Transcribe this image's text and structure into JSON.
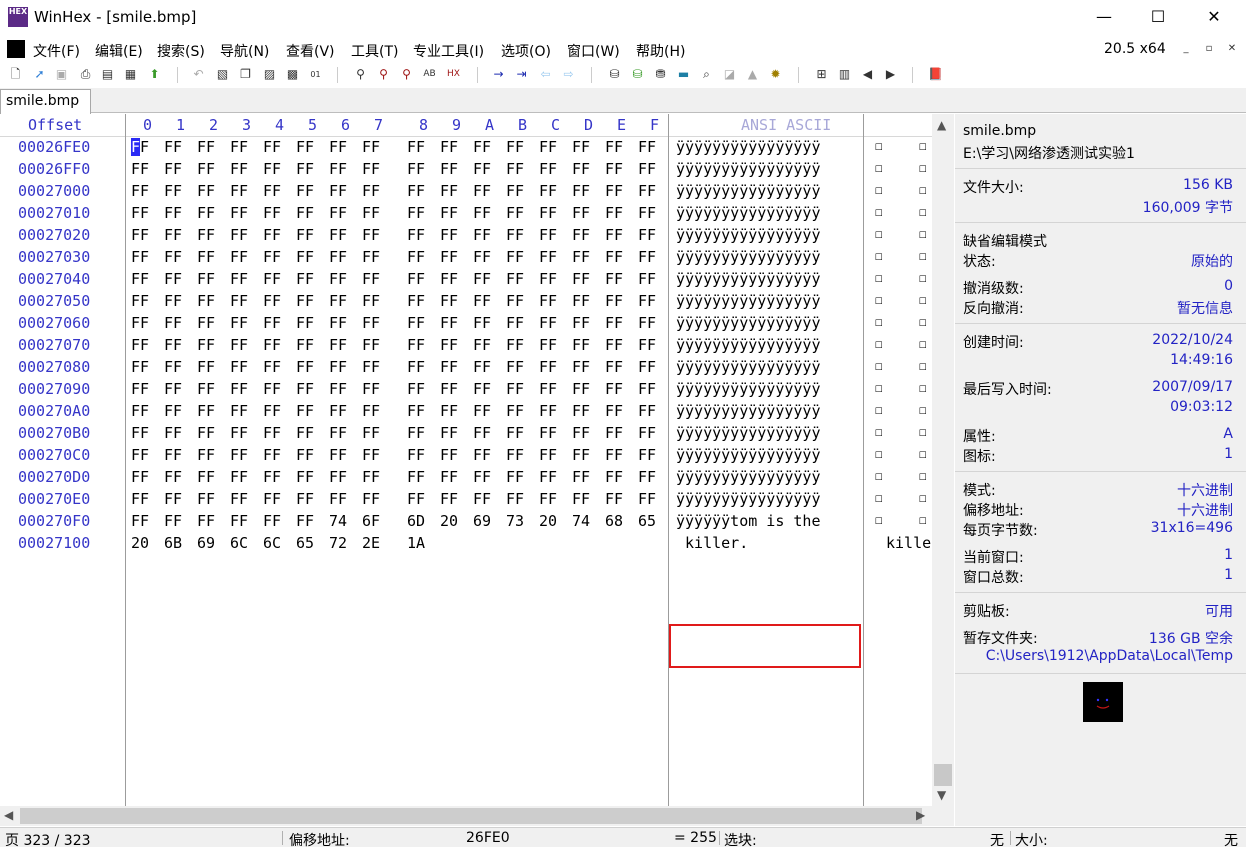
{
  "window": {
    "title": "WinHex - [smile.bmp]",
    "app_icon_text": "HEX"
  },
  "menu": {
    "items": [
      "文件(F)",
      "编辑(E)",
      "搜索(S)",
      "导航(N)",
      "查看(V)",
      "工具(T)",
      "专业工具(I)",
      "选项(O)",
      "窗口(W)",
      "帮助(H)"
    ],
    "version": "20.5 x64"
  },
  "tab": {
    "label": "smile.bmp"
  },
  "hex": {
    "offset_header": "Offset",
    "column_headers": [
      "0",
      "1",
      "2",
      "3",
      "4",
      "5",
      "6",
      "7",
      "8",
      "9",
      "A",
      "B",
      "C",
      "D",
      "E",
      "F"
    ],
    "ascii_header": "ANSI ASCII",
    "rows": [
      {
        "offset": "00026FE0",
        "bytes": [
          "FF",
          "FF",
          "FF",
          "FF",
          "FF",
          "FF",
          "FF",
          "FF",
          "FF",
          "FF",
          "FF",
          "FF",
          "FF",
          "FF",
          "FF",
          "FF"
        ],
        "ascii": "ÿÿÿÿÿÿÿÿÿÿÿÿÿÿÿÿ"
      },
      {
        "offset": "00026FF0",
        "bytes": [
          "FF",
          "FF",
          "FF",
          "FF",
          "FF",
          "FF",
          "FF",
          "FF",
          "FF",
          "FF",
          "FF",
          "FF",
          "FF",
          "FF",
          "FF",
          "FF"
        ],
        "ascii": "ÿÿÿÿÿÿÿÿÿÿÿÿÿÿÿÿ"
      },
      {
        "offset": "00027000",
        "bytes": [
          "FF",
          "FF",
          "FF",
          "FF",
          "FF",
          "FF",
          "FF",
          "FF",
          "FF",
          "FF",
          "FF",
          "FF",
          "FF",
          "FF",
          "FF",
          "FF"
        ],
        "ascii": "ÿÿÿÿÿÿÿÿÿÿÿÿÿÿÿÿ"
      },
      {
        "offset": "00027010",
        "bytes": [
          "FF",
          "FF",
          "FF",
          "FF",
          "FF",
          "FF",
          "FF",
          "FF",
          "FF",
          "FF",
          "FF",
          "FF",
          "FF",
          "FF",
          "FF",
          "FF"
        ],
        "ascii": "ÿÿÿÿÿÿÿÿÿÿÿÿÿÿÿÿ"
      },
      {
        "offset": "00027020",
        "bytes": [
          "FF",
          "FF",
          "FF",
          "FF",
          "FF",
          "FF",
          "FF",
          "FF",
          "FF",
          "FF",
          "FF",
          "FF",
          "FF",
          "FF",
          "FF",
          "FF"
        ],
        "ascii": "ÿÿÿÿÿÿÿÿÿÿÿÿÿÿÿÿ"
      },
      {
        "offset": "00027030",
        "bytes": [
          "FF",
          "FF",
          "FF",
          "FF",
          "FF",
          "FF",
          "FF",
          "FF",
          "FF",
          "FF",
          "FF",
          "FF",
          "FF",
          "FF",
          "FF",
          "FF"
        ],
        "ascii": "ÿÿÿÿÿÿÿÿÿÿÿÿÿÿÿÿ"
      },
      {
        "offset": "00027040",
        "bytes": [
          "FF",
          "FF",
          "FF",
          "FF",
          "FF",
          "FF",
          "FF",
          "FF",
          "FF",
          "FF",
          "FF",
          "FF",
          "FF",
          "FF",
          "FF",
          "FF"
        ],
        "ascii": "ÿÿÿÿÿÿÿÿÿÿÿÿÿÿÿÿ"
      },
      {
        "offset": "00027050",
        "bytes": [
          "FF",
          "FF",
          "FF",
          "FF",
          "FF",
          "FF",
          "FF",
          "FF",
          "FF",
          "FF",
          "FF",
          "FF",
          "FF",
          "FF",
          "FF",
          "FF"
        ],
        "ascii": "ÿÿÿÿÿÿÿÿÿÿÿÿÿÿÿÿ"
      },
      {
        "offset": "00027060",
        "bytes": [
          "FF",
          "FF",
          "FF",
          "FF",
          "FF",
          "FF",
          "FF",
          "FF",
          "FF",
          "FF",
          "FF",
          "FF",
          "FF",
          "FF",
          "FF",
          "FF"
        ],
        "ascii": "ÿÿÿÿÿÿÿÿÿÿÿÿÿÿÿÿ"
      },
      {
        "offset": "00027070",
        "bytes": [
          "FF",
          "FF",
          "FF",
          "FF",
          "FF",
          "FF",
          "FF",
          "FF",
          "FF",
          "FF",
          "FF",
          "FF",
          "FF",
          "FF",
          "FF",
          "FF"
        ],
        "ascii": "ÿÿÿÿÿÿÿÿÿÿÿÿÿÿÿÿ"
      },
      {
        "offset": "00027080",
        "bytes": [
          "FF",
          "FF",
          "FF",
          "FF",
          "FF",
          "FF",
          "FF",
          "FF",
          "FF",
          "FF",
          "FF",
          "FF",
          "FF",
          "FF",
          "FF",
          "FF"
        ],
        "ascii": "ÿÿÿÿÿÿÿÿÿÿÿÿÿÿÿÿ"
      },
      {
        "offset": "00027090",
        "bytes": [
          "FF",
          "FF",
          "FF",
          "FF",
          "FF",
          "FF",
          "FF",
          "FF",
          "FF",
          "FF",
          "FF",
          "FF",
          "FF",
          "FF",
          "FF",
          "FF"
        ],
        "ascii": "ÿÿÿÿÿÿÿÿÿÿÿÿÿÿÿÿ"
      },
      {
        "offset": "000270A0",
        "bytes": [
          "FF",
          "FF",
          "FF",
          "FF",
          "FF",
          "FF",
          "FF",
          "FF",
          "FF",
          "FF",
          "FF",
          "FF",
          "FF",
          "FF",
          "FF",
          "FF"
        ],
        "ascii": "ÿÿÿÿÿÿÿÿÿÿÿÿÿÿÿÿ"
      },
      {
        "offset": "000270B0",
        "bytes": [
          "FF",
          "FF",
          "FF",
          "FF",
          "FF",
          "FF",
          "FF",
          "FF",
          "FF",
          "FF",
          "FF",
          "FF",
          "FF",
          "FF",
          "FF",
          "FF"
        ],
        "ascii": "ÿÿÿÿÿÿÿÿÿÿÿÿÿÿÿÿ"
      },
      {
        "offset": "000270C0",
        "bytes": [
          "FF",
          "FF",
          "FF",
          "FF",
          "FF",
          "FF",
          "FF",
          "FF",
          "FF",
          "FF",
          "FF",
          "FF",
          "FF",
          "FF",
          "FF",
          "FF"
        ],
        "ascii": "ÿÿÿÿÿÿÿÿÿÿÿÿÿÿÿÿ"
      },
      {
        "offset": "000270D0",
        "bytes": [
          "FF",
          "FF",
          "FF",
          "FF",
          "FF",
          "FF",
          "FF",
          "FF",
          "FF",
          "FF",
          "FF",
          "FF",
          "FF",
          "FF",
          "FF",
          "FF"
        ],
        "ascii": "ÿÿÿÿÿÿÿÿÿÿÿÿÿÿÿÿ"
      },
      {
        "offset": "000270E0",
        "bytes": [
          "FF",
          "FF",
          "FF",
          "FF",
          "FF",
          "FF",
          "FF",
          "FF",
          "FF",
          "FF",
          "FF",
          "FF",
          "FF",
          "FF",
          "FF",
          "FF"
        ],
        "ascii": "ÿÿÿÿÿÿÿÿÿÿÿÿÿÿÿÿ"
      },
      {
        "offset": "000270F0",
        "bytes": [
          "FF",
          "FF",
          "FF",
          "FF",
          "FF",
          "FF",
          "74",
          "6F",
          "6D",
          "20",
          "69",
          "73",
          "20",
          "74",
          "68",
          "65"
        ],
        "ascii": "ÿÿÿÿÿÿtom is the"
      },
      {
        "offset": "00027100",
        "bytes": [
          "20",
          "6B",
          "69",
          "6C",
          "6C",
          "65",
          "72",
          "2E",
          "1A"
        ],
        "ascii": " killer."
      }
    ],
    "extra_column_tail": "kille"
  },
  "info": {
    "filename": "smile.bmp",
    "path": "E:\\学习\\网络渗透测试实验1",
    "file_size_label": "文件大小:",
    "file_size_kb": "156 KB",
    "file_size_bytes": "160,009 字节",
    "edit_mode_label": "缺省编辑模式",
    "state_label": "状态:",
    "state_value": "原始的",
    "undo_level_label": "撤消级数:",
    "undo_level_value": "0",
    "redo_label": "反向撤消:",
    "redo_value": "暂无信息",
    "created_label": "创建时间:",
    "created_date": "2022/10/24",
    "created_time": "14:49:16",
    "modified_label": "最后写入时间:",
    "modified_date": "2007/09/17",
    "modified_time": "09:03:12",
    "attr_label": "属性:",
    "attr_value": "A",
    "icon_label": "图标:",
    "icon_value": "1",
    "mode_label": "模式:",
    "mode_value": "十六进制",
    "offset_label": "偏移地址:",
    "offset_value": "十六进制",
    "bytes_per_page_label": "每页字节数:",
    "bytes_per_page_value": "31x16=496",
    "current_window_label": "当前窗口:",
    "current_window_value": "1",
    "window_total_label": "窗口总数:",
    "window_total_value": "1",
    "clipboard_label": "剪贴板:",
    "clipboard_value": "可用",
    "temp_label": "暂存文件夹:",
    "temp_value": "136 GB 空余",
    "temp_path": "C:\\Users\\1912\\AppData\\Local\\Temp"
  },
  "status": {
    "page": "页 323 / 323",
    "offset_label": "偏移地址:",
    "offset_value": "26FE0",
    "equals": "= 255",
    "selection_label": "选块:",
    "selection_value": "无",
    "size_label": "大小:",
    "size_value": "无"
  },
  "colors": {
    "accent": "#3535c8",
    "cursor": "#2a2af5",
    "highlight_box": "#e01a1a"
  }
}
